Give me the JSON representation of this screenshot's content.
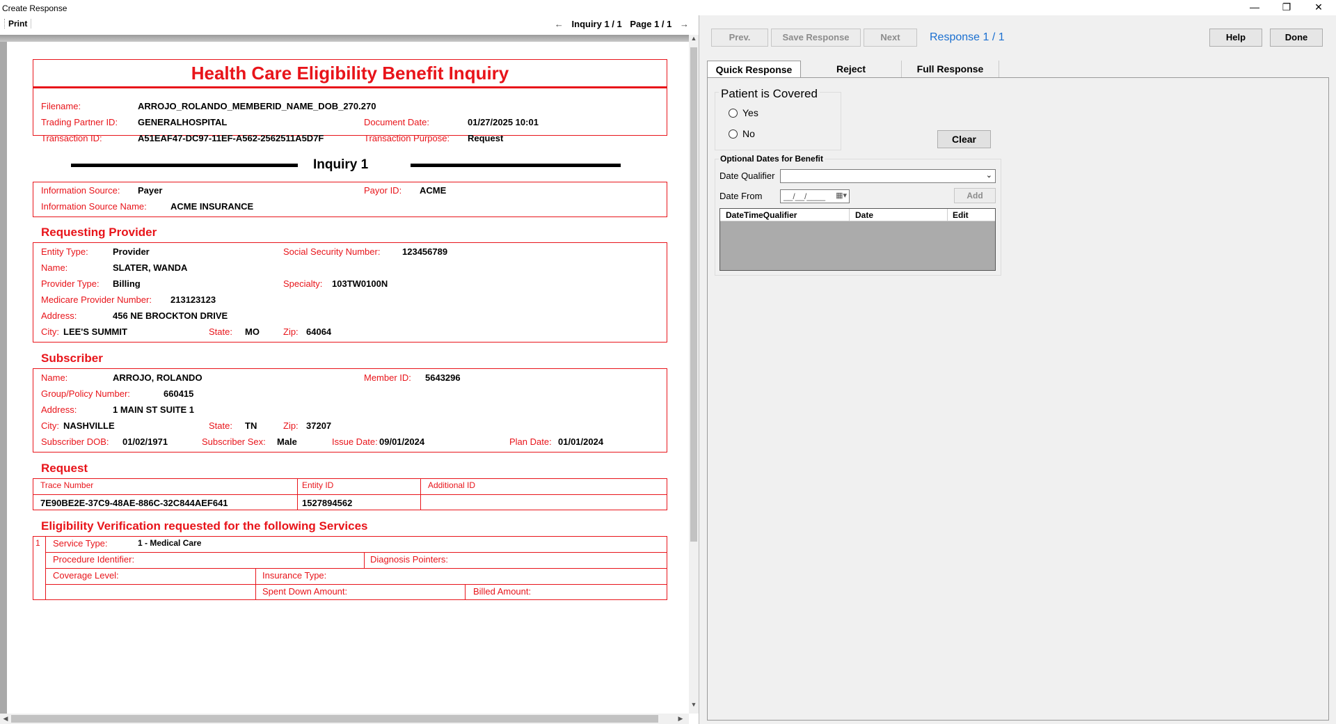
{
  "window": {
    "title": "Create Response",
    "minimize": "—",
    "restore": "❐",
    "close": "✕"
  },
  "toolbar": {
    "print_label": "Print",
    "prev_arrow": "←",
    "inquiry": "Inquiry 1 / 1",
    "page": "Page 1 / 1",
    "next_arrow": "→"
  },
  "report": {
    "title": "Health Care Eligibility Benefit Inquiry",
    "header": {
      "filename_label": "Filename:",
      "filename": "ARROJO_ROLANDO_MEMBERID_NAME_DOB_270.270",
      "trading_partner_label": "Trading Partner ID:",
      "trading_partner": "GENERALHOSPITAL",
      "document_date_label": "Document Date:",
      "document_date": "01/27/2025 10:01",
      "transaction_id_label": "Transaction ID:",
      "transaction_id": "A51EAF47-DC97-11EF-A562-2562511A5D7F",
      "transaction_purpose_label": "Transaction Purpose:",
      "transaction_purpose": "Request"
    },
    "inquiry_heading": "Inquiry 1",
    "source": {
      "info_source_label": "Information Source:",
      "info_source": "Payer",
      "payor_id_label": "Payor ID:",
      "payor_id": "ACME",
      "info_source_name_label": "Information Source Name:",
      "info_source_name": "ACME INSURANCE"
    },
    "provider": {
      "heading": "Requesting Provider",
      "entity_type_label": "Entity Type:",
      "entity_type": "Provider",
      "ssn_label": "Social Security Number:",
      "ssn": "123456789",
      "name_label": "Name:",
      "name": "SLATER, WANDA",
      "provider_type_label": "Provider Type:",
      "provider_type": "Billing",
      "specialty_label": "Specialty:",
      "specialty": "103TW0100N",
      "medicare_label": "Medicare Provider Number:",
      "medicare": "213123123",
      "address_label": "Address:",
      "address": "456 NE BROCKTON DRIVE",
      "city_label": "City:",
      "city": "LEE'S SUMMIT",
      "state_label": "State:",
      "state": "MO",
      "zip_label": "Zip:",
      "zip": "64064"
    },
    "subscriber": {
      "heading": "Subscriber",
      "name_label": "Name:",
      "name": "ARROJO, ROLANDO",
      "member_id_label": "Member ID:",
      "member_id": "5643296",
      "group_label": "Group/Policy Number:",
      "group": "660415",
      "address_label": "Address:",
      "address": "1 MAIN ST SUITE 1",
      "city_label": "City:",
      "city": "NASHVILLE",
      "state_label": "State:",
      "state": "TN",
      "zip_label": "Zip:",
      "zip": "37207",
      "dob_label": "Subscriber DOB:",
      "dob": "01/02/1971",
      "sex_label": "Subscriber Sex:",
      "sex": "Male",
      "issue_date_label": "Issue Date:",
      "issue_date": "09/01/2024",
      "plan_date_label": "Plan Date:",
      "plan_date": "01/01/2024"
    },
    "request": {
      "heading": "Request",
      "trace_label": "Trace Number",
      "trace": "7E90BE2E-37C9-48AE-886C-32C844AEF641",
      "entity_id_label": "Entity ID",
      "entity_id": "1527894562",
      "additional_id_label": "Additional ID",
      "additional_id": ""
    },
    "services": {
      "heading": "Eligibility Verification requested for the following Services",
      "row_number": "1",
      "service_type_label": "Service Type:",
      "service_type": "1 - Medical Care",
      "procedure_label": "Procedure Identifier:",
      "diagnosis_label": "Diagnosis Pointers:",
      "coverage_label": "Coverage Level:",
      "insurance_type_label": "Insurance Type:",
      "spent_down_label": "Spent Down Amount:",
      "billed_label": "Billed Amount:"
    }
  },
  "response_pane": {
    "prev_label": "Prev.",
    "save_label": "Save Response",
    "next_label": "Next",
    "response_counter": "Response 1 / 1",
    "help_label": "Help",
    "done_label": "Done",
    "tabs": [
      "Quick Response",
      "Reject",
      "Full Response"
    ],
    "patient_covered_title": "Patient is Covered",
    "yes_label": "Yes",
    "no_label": "No",
    "clear_label": "Clear",
    "optional_dates_title": "Optional Dates for Benefit",
    "date_qualifier_label": "Date Qualifier",
    "date_qualifier_value": "",
    "date_from_label": "Date From",
    "date_from_value": "__/__/____",
    "add_label": "Add",
    "grid_columns": [
      "DateTimeQualifier",
      "Date",
      "Edit"
    ]
  },
  "colors": {
    "report_red": "#e8141a",
    "link_blue": "#1a6fd0"
  }
}
